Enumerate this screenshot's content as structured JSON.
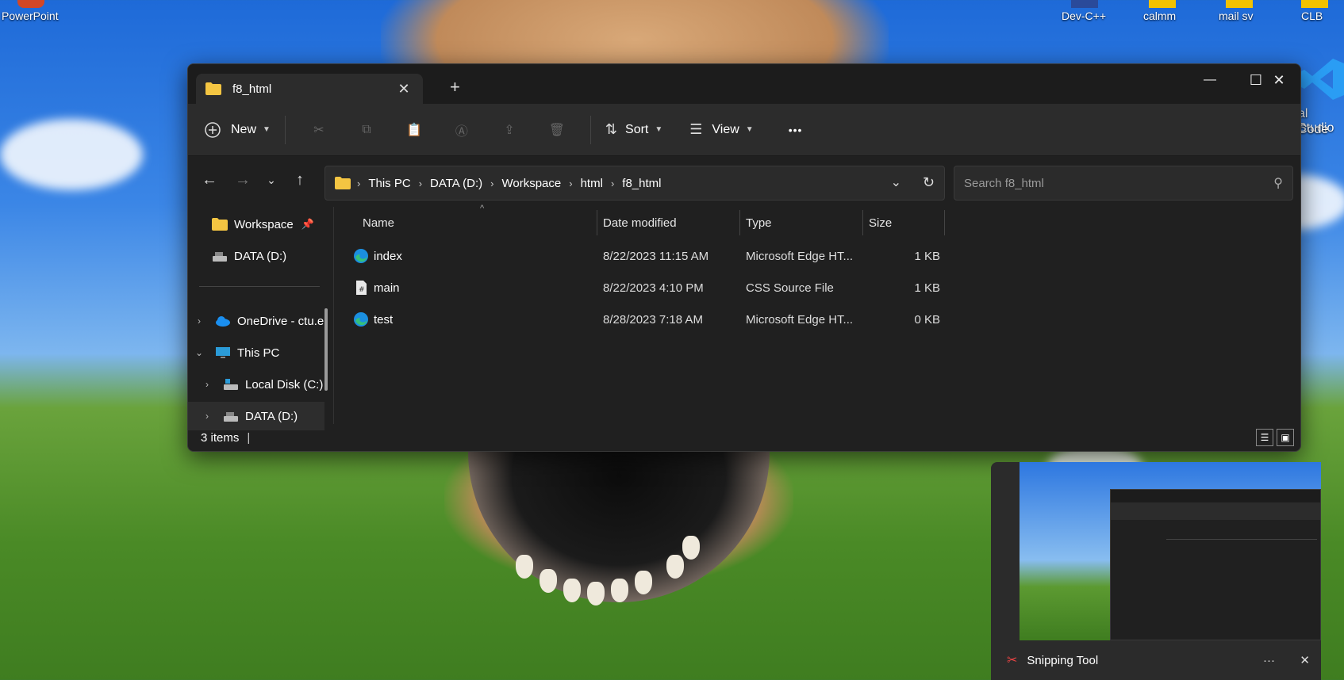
{
  "desktop": {
    "icons": [
      {
        "label": "PowerPoint"
      },
      {
        "label": "Dev-C++"
      },
      {
        "label": "calmm"
      },
      {
        "label": "mail sv"
      },
      {
        "label": "CLB"
      },
      {
        "label": "al Studio"
      },
      {
        "label": "Code"
      }
    ]
  },
  "window": {
    "tab_title": "f8_html",
    "new_tab_icon": "plus-icon",
    "controls": {
      "minimize": "—",
      "maximize": "☐",
      "close": "✕"
    }
  },
  "toolbar": {
    "new_label": "New",
    "sort_label": "Sort",
    "view_label": "View",
    "more_label": "•••"
  },
  "address": {
    "crumbs": [
      "This PC",
      "DATA (D:)",
      "Workspace",
      "html",
      "f8_html"
    ]
  },
  "search": {
    "placeholder": "Search f8_html"
  },
  "navpane": {
    "items": [
      {
        "label": "Workspace",
        "pinned": true
      },
      {
        "label": "DATA (D:)"
      },
      {
        "label": "OneDrive - ctu.e"
      },
      {
        "label": "This PC"
      },
      {
        "label": "Local Disk (C:)"
      },
      {
        "label": "DATA (D:)"
      }
    ]
  },
  "files": {
    "columns": [
      "Name",
      "Date modified",
      "Type",
      "Size"
    ],
    "rows": [
      {
        "name": "index",
        "date": "8/22/2023 11:15 AM",
        "type": "Microsoft Edge HT...",
        "size": "1 KB",
        "icon": "edge-icon"
      },
      {
        "name": "main",
        "date": "8/22/2023 4:10 PM",
        "type": "CSS Source File",
        "size": "1 KB",
        "icon": "css-file-icon"
      },
      {
        "name": "test",
        "date": "8/28/2023 7:18 AM",
        "type": "Microsoft Edge HT...",
        "size": "0 KB",
        "icon": "edge-icon"
      }
    ]
  },
  "status": {
    "count": "3 items"
  },
  "snipping": {
    "app_name": "Snipping Tool",
    "more": "···",
    "close": "✕"
  },
  "colors": {
    "window_bg": "#202020",
    "toolbar_bg": "#2c2c2c",
    "folder": "#f4c542",
    "edge_blue": "#1b8fe0",
    "edge_green": "#36c07a"
  }
}
